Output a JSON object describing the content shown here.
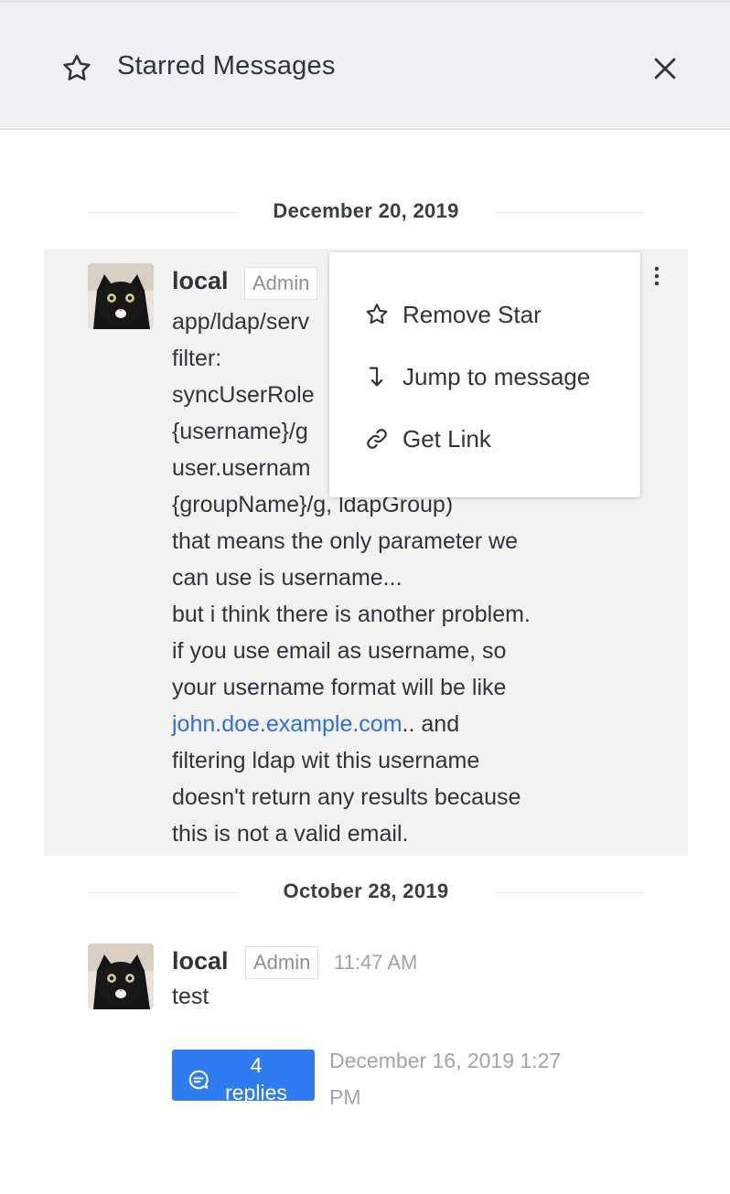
{
  "header": {
    "title": "Starred Messages",
    "star_icon": "star-outline-icon",
    "close_icon": "close-icon"
  },
  "groups": [
    {
      "date": "December 20, 2019",
      "message": {
        "username": "local",
        "role": "Admin",
        "lines": [
          "app/ldap/serv",
          "filter:",
          "syncUserRole",
          "{username}/g",
          "user.usernam",
          "{groupName}/g, ldapGroup)",
          "that means the only parameter we",
          "can use is username...",
          "but i think there is another problem.",
          "if you use email as username, so",
          "your username format will be like"
        ],
        "link_text": "john.doe.example.com",
        "after_link": ".. and",
        "lines_after": [
          "filtering ldap wit this username",
          "doesn't return any results because",
          "this is not a valid email."
        ]
      }
    },
    {
      "date": "October 28, 2019",
      "message": {
        "username": "local",
        "role": "Admin",
        "time": "11:47 AM",
        "text": "test",
        "replies_count": "4",
        "replies_label": "replies",
        "thread_date_line1": "December 16, 2019 1:27",
        "thread_date_line2": "PM"
      }
    }
  ],
  "context_menu": {
    "items": [
      {
        "label": "Remove Star",
        "icon": "star-outline-icon"
      },
      {
        "label": "Jump to message",
        "icon": "jump-arrow-icon"
      },
      {
        "label": "Get Link",
        "icon": "link-icon"
      }
    ]
  },
  "colors": {
    "header_bg": "#eef0f3",
    "highlight_bg": "#f2f2f1",
    "link": "#2f6fd8",
    "accent_button": "#2f7cf0"
  }
}
